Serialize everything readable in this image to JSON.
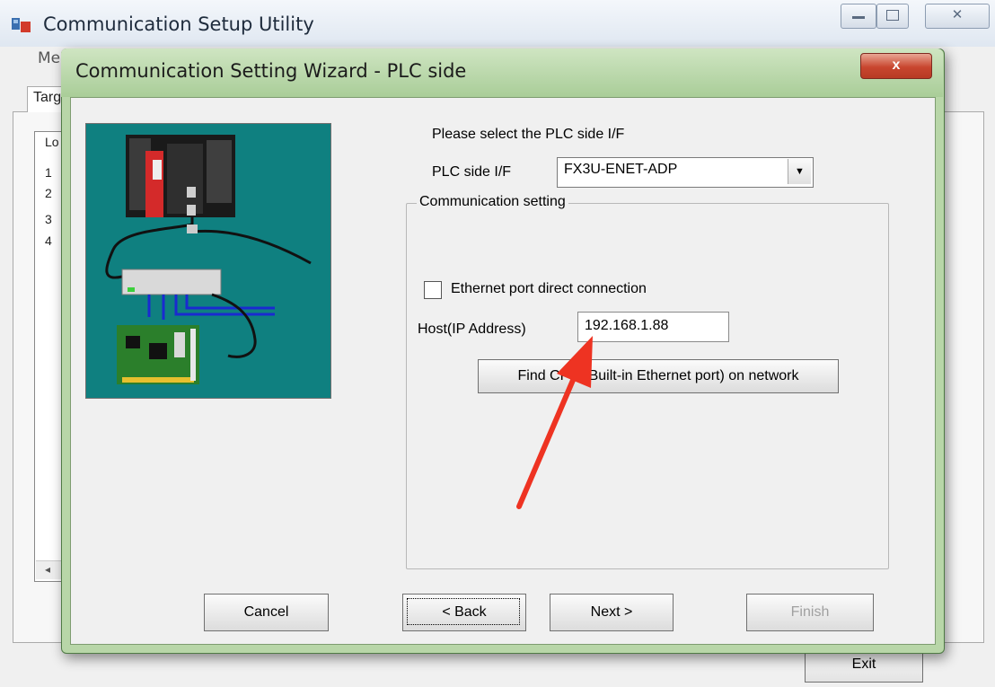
{
  "main_window": {
    "title": "Communication Setup Utility",
    "menu_label": "Men",
    "tab_label": "Targ",
    "list_header": "Lo",
    "list_items": [
      "1",
      "2",
      "3",
      "4"
    ],
    "scroll_left_glyph": "◂",
    "exit_label": "Exit",
    "minimize_glyph": "▭",
    "maximize_glyph": "□",
    "close_glyph": "✕"
  },
  "dialog": {
    "title": "Communication Setting Wizard - PLC side",
    "close_glyph": "x",
    "prompt": "Please select the PLC side I/F",
    "plc_if_label": "PLC side I/F",
    "plc_if_value": "FX3U-ENET-ADP",
    "select_arrow_glyph": "▼",
    "group_title": "Communication setting",
    "ethernet_direct": {
      "label": "Ethernet port direct connection",
      "checked": false
    },
    "host_label": "Host(IP Address)",
    "host_value": "192.168.1.88",
    "find_cpu_label": "Find CPU (Built-in Ethernet port) on network",
    "buttons": {
      "cancel": "Cancel",
      "back": "< Back",
      "next": "Next >",
      "finish": "Finish"
    }
  },
  "colors": {
    "dialog_frame": "#b8d6a8",
    "illustration_bg": "#0f8080",
    "annotation_arrow": "#ee3322"
  }
}
